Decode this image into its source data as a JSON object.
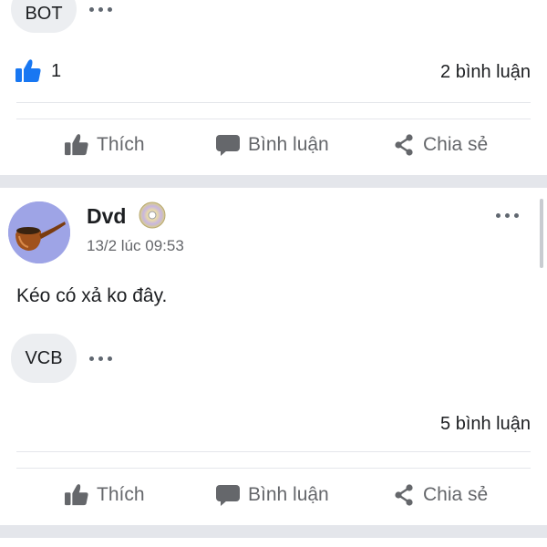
{
  "post1": {
    "reaction_chip": "BOT",
    "like_count": "1",
    "comment_count": "2 bình luận"
  },
  "actions": {
    "like": "Thích",
    "comment": "Bình luận",
    "share": "Chia sẻ"
  },
  "post2": {
    "author": "Dvd",
    "timestamp": "13/2 lúc 09:53",
    "text": "Kéo có xả ko đây.",
    "reaction_chip": "VCB",
    "comment_count": "5 bình luận"
  },
  "colors": {
    "like_icon_blue": "#1877f2",
    "action_grey": "#65676b",
    "separator": "#e4e6eb",
    "chip_bg": "#eceef1",
    "avatar_bg": "#9ea4e6"
  },
  "icons": [
    "thumbs-up-icon",
    "comment-icon",
    "share-icon",
    "more-options-icon",
    "cd-badge-icon",
    "pipe-avatar"
  ]
}
